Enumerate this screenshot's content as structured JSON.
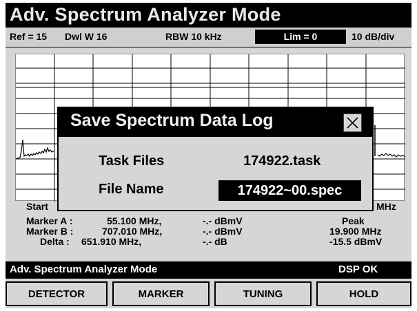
{
  "title": "Adv. Spectrum Analyzer Mode",
  "status": {
    "ref": "Ref = 15",
    "dwell": "Dwl W 16",
    "rbw": "RBW 10 kHz",
    "limit": "Lim = 0",
    "scale": "10 dB/div"
  },
  "plot": {
    "start_label": "Start",
    "stop_label": "MHz"
  },
  "markers": {
    "a_label": "Marker A :",
    "a_freq": "55.100 MHz,",
    "a_level": "-.- dBmV",
    "b_label": "Marker B :",
    "b_freq": "707.010 MHz,",
    "b_level": "-.- dBmV",
    "delta_label": "Delta :",
    "delta_freq": "651.910 MHz,",
    "delta_level": "-.- dB",
    "peak_label": "Peak",
    "peak_freq": "19.900 MHz",
    "peak_level": "-15.5 dBmV"
  },
  "mode_bar": {
    "mode": "Adv. Spectrum Analyzer Mode",
    "dsp": "DSP OK"
  },
  "softkeys": [
    "DETECTOR",
    "MARKER",
    "TUNING",
    "HOLD"
  ],
  "dialog": {
    "title": "Save Spectrum Data Log",
    "task_label": "Task Files",
    "task_value": "174922.task",
    "file_label": "File Name",
    "file_value": "174922~00.spec"
  }
}
